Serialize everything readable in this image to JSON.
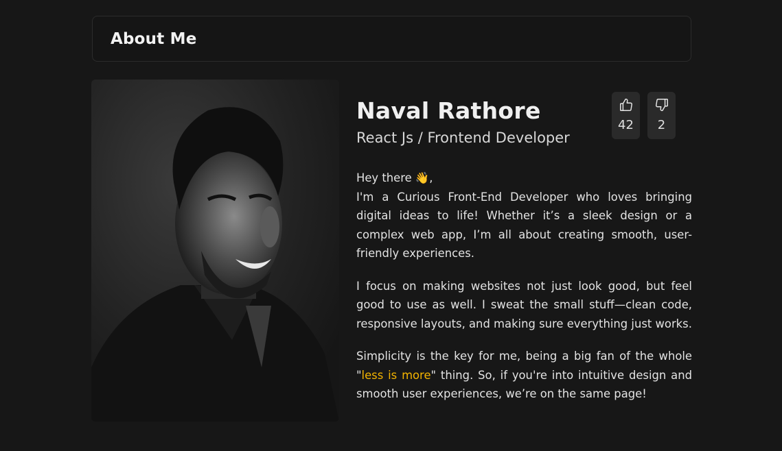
{
  "header": {
    "title": "About Me"
  },
  "profile": {
    "name": "Naval Rathore",
    "role": "React Js / Frontend Developer",
    "photo_alt": "Portrait"
  },
  "votes": {
    "likes": "42",
    "dislikes": "2",
    "like_icon": "thumbs-up-icon",
    "dislike_icon": "thumbs-down-icon"
  },
  "bio": {
    "greeting": "Hey there 👋,",
    "p1": "I'm a Curious Front-End Developer who loves bringing digital ideas to life! Whether it’s a sleek design or a complex web app, I’m all about creating smooth, user-friendly experiences.",
    "p2": "I focus on making websites not just look good, but feel good to use as well. I sweat the small stuff—clean code, responsive layouts, and making sure everything just works.",
    "p3_before": "Simplicity is the key for me, being a big fan of the whole \"",
    "p3_highlight": "less is more",
    "p3_after": "\" thing. So, if you're into intuitive design and smooth user experiences, we’re on the same page!"
  },
  "colors": {
    "background": "#171717",
    "highlight": "#f4b400",
    "card": "#2a2a2a"
  }
}
